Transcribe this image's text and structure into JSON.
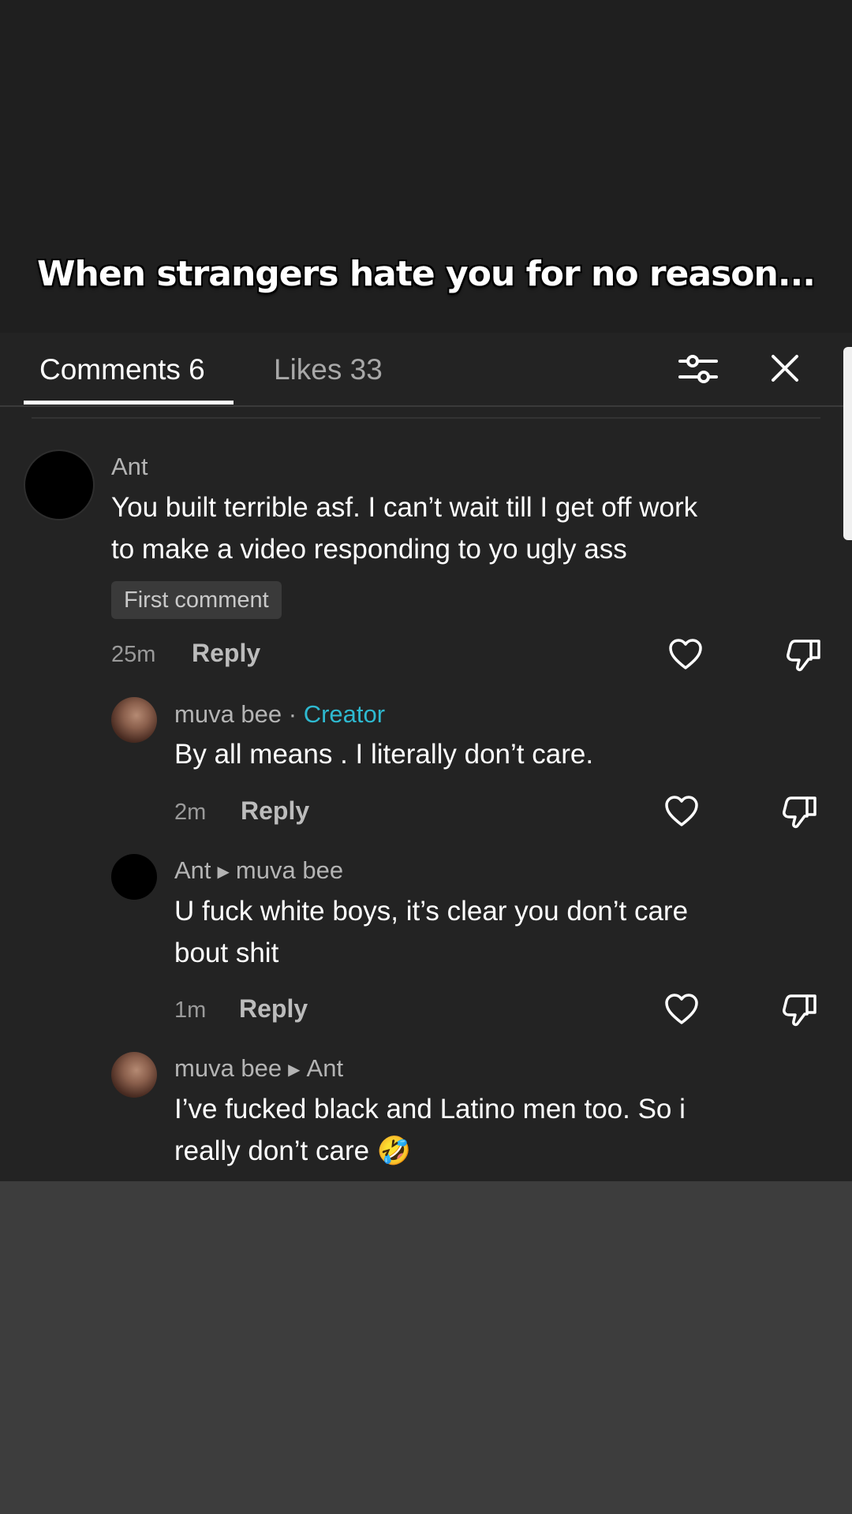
{
  "caption": "When strangers hate you for no reason...",
  "tabs": {
    "comments": "Comments 6",
    "likes": "Likes 33"
  },
  "icons": {
    "filter": "sliders-icon",
    "close": "close-icon",
    "like": "heart-icon",
    "dislike": "thumbs-down-icon"
  },
  "colors": {
    "creator": "#2eb9d0",
    "panel": "#232323"
  },
  "comments": [
    {
      "user": "Ant",
      "text_line1": "You built terrible asf. I can’t wait till I get off work",
      "text_line2": "to make a video responding to yo ugly ass",
      "badge": "First comment",
      "time": "25m",
      "reply": "Reply"
    },
    {
      "user": "muva bee",
      "separator": " · ",
      "creator_label": "Creator",
      "text_line1": "By all means . I literally don’t care.",
      "time": "2m",
      "reply": "Reply"
    },
    {
      "user": "Ant",
      "reply_to": "muva bee",
      "text_line1": "U fuck white boys, it’s clear you don’t care",
      "text_line2": "bout shit",
      "time": "1m",
      "reply": "Reply"
    },
    {
      "user": "muva bee",
      "reply_to": "Ant",
      "text_line1": "I’ve fucked black and Latino men too. So i",
      "text_line2": "really don’t care 🤣"
    }
  ]
}
